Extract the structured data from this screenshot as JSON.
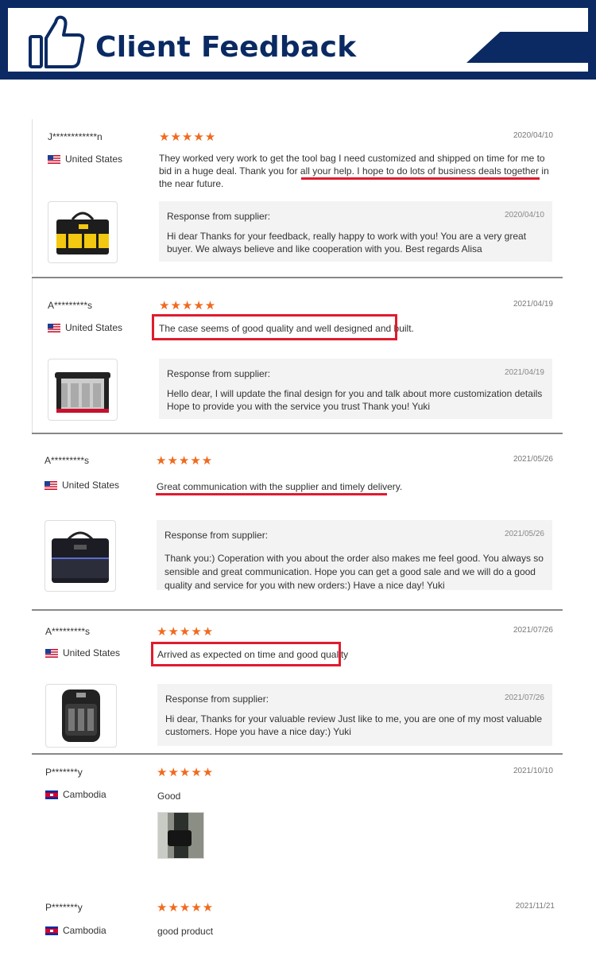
{
  "header": {
    "title": "Client Feedback",
    "color": "#0b2a63",
    "icon": "thumbs-up-icon"
  },
  "reviews": [
    {
      "reviewer": "J************n",
      "country": "United States",
      "flag": "us",
      "rating": 5,
      "stars": "★★★★★",
      "date": "2020/04/10",
      "comment": "They worked very work to get the tool bag I need customized and shipped on time for me to bid in a huge deal. Thank you for all your help. I hope to do lots of business deals together in the near future.",
      "response_label": "Response from supplier:",
      "response_date": "2020/04/10",
      "response": "Hi dear Thanks for your feedback, really happy to work with you! You are a very great buyer. We always believe and like cooperation with you. Best regards Alisa",
      "product": "yellow-tool-bag"
    },
    {
      "reviewer": "A*********s",
      "country": "United States",
      "flag": "us",
      "rating": 5,
      "stars": "★★★★★",
      "date": "2021/04/19",
      "comment": "The case seems of good quality and well designed and built.",
      "response_label": "Response from supplier:",
      "response_date": "2021/04/19",
      "response": "Hello dear, I will update the final design for you and talk about more customization details Hope to provide you with the service you trust Thank you! Yuki",
      "product": "open-tool-tote"
    },
    {
      "reviewer": "A*********s",
      "country": "United States",
      "flag": "us",
      "rating": 5,
      "stars": "★★★★★",
      "date": "2021/05/26",
      "comment": "Great communication with the supplier and timely delivery.",
      "response_label": "Response from supplier:",
      "response_date": "2021/05/26",
      "response": "Thank you:) Coperation with you about the order also makes me feel good. You always so sensible and great communication. Hope you can get a good sale and we will do a good quality and service for you with new orders:) Have a nice day! Yuki",
      "product": "black-tool-bag"
    },
    {
      "reviewer": "A*********s",
      "country": "United States",
      "flag": "us",
      "rating": 5,
      "stars": "★★★★★",
      "date": "2021/07/26",
      "comment": "Arrived as expected on time and good quality",
      "response_label": "Response from supplier:",
      "response_date": "2021/07/26",
      "response": "Hi dear, Thanks for your valuable review Just like to me, you are one of my most valuable customers. Hope you have a nice day:) Yuki",
      "product": "tool-backpack"
    },
    {
      "reviewer": "P*******y",
      "country": "Cambodia",
      "flag": "kh",
      "rating": 5,
      "stars": "★★★★★",
      "date": "2021/10/10",
      "comment": "Good",
      "product": "customer-photo"
    },
    {
      "reviewer": "P*******y",
      "country": "Cambodia",
      "flag": "kh",
      "rating": 5,
      "stars": "★★★★★",
      "date": "2021/11/21",
      "comment": "good product"
    }
  ],
  "colors": {
    "star": "#f06a1e",
    "highlight": "#e01b2e",
    "navy": "#0b2a63"
  }
}
